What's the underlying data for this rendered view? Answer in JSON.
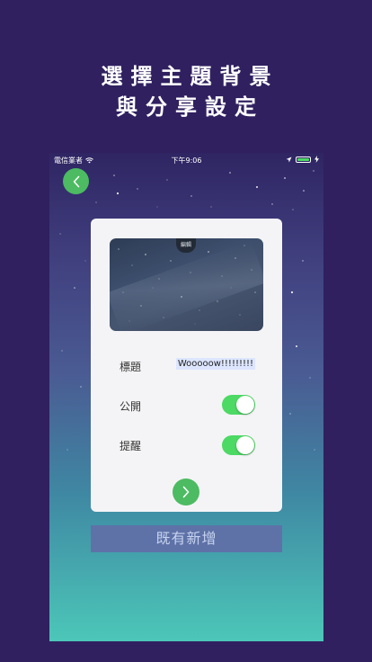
{
  "headline": {
    "line1": "選擇主題背景",
    "line2": "與分享設定"
  },
  "statusbar": {
    "carrier": "電信業者",
    "time": "下午9:06"
  },
  "photo": {
    "edit_label": "編輯"
  },
  "form": {
    "title_label": "標題",
    "title_value": "Wooooow!!!!!!!!!",
    "public_label": "公開",
    "public_on": true,
    "reminder_label": "提醒",
    "reminder_on": true
  },
  "existing_button": "既有新增",
  "colors": {
    "accent": "#4cbb62",
    "toggle_on": "#4cd964",
    "background": "#302060",
    "existing_button": "#5e72a8"
  },
  "icons": {
    "back": "chevron-left-icon",
    "next": "chevron-right-icon",
    "wifi": "wifi-icon",
    "location": "location-arrow-icon",
    "battery": "battery-icon",
    "charging": "charging-bolt-icon"
  }
}
